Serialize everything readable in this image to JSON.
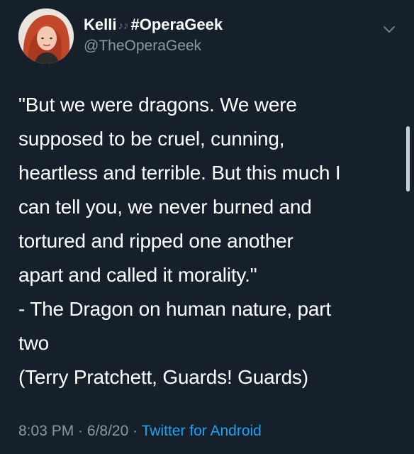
{
  "tweet": {
    "author": {
      "name": "Kelli",
      "name_tag": "#OperaGeek",
      "name_icon": "musical-notes-icon",
      "handle": "@TheOperaGeek"
    },
    "menu_icon": "chevron-down-icon",
    "lines": [
      "\"But we were dragons. We were",
      "supposed to be cruel, cunning,",
      "heartless and terrible. But this much I",
      "can tell you, we never burned and",
      "tortured and ripped one another",
      "apart and called it morality.\"",
      "- The Dragon on human nature, part",
      "two",
      "(Terry Pratchett, Guards! Guards)"
    ],
    "time": "8:03 PM",
    "separator": "·",
    "date": "6/8/20",
    "source": "Twitter for Android"
  },
  "colors": {
    "background": "#15202b",
    "text": "#ffffff",
    "secondary": "#8899a6",
    "link": "#1da1f2"
  }
}
